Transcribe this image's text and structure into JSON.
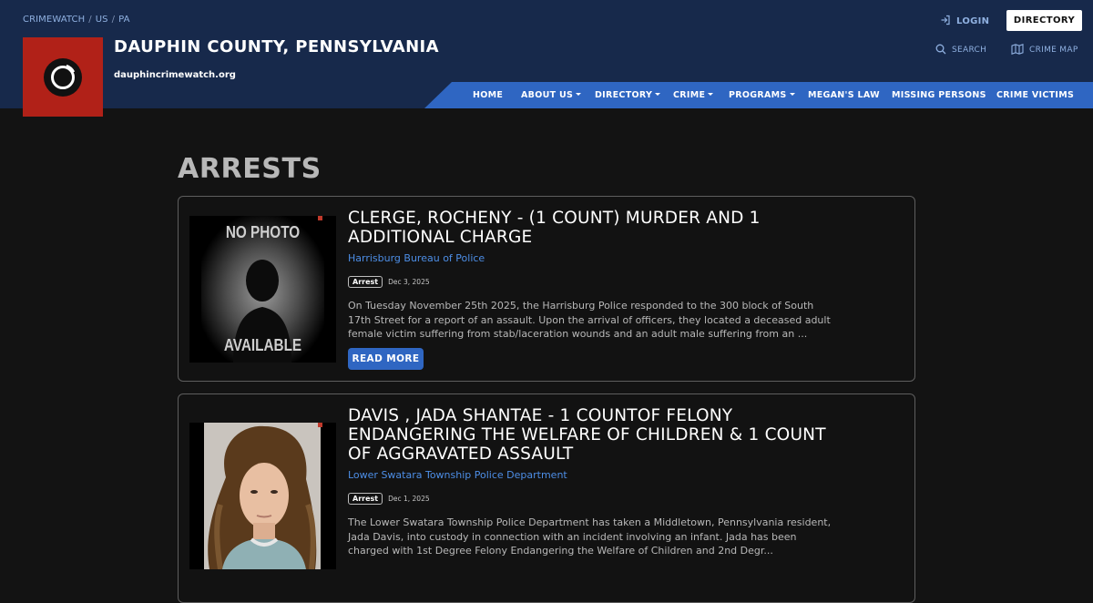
{
  "breadcrumb": [
    "CRIMEWATCH",
    "US",
    "PA"
  ],
  "site": {
    "title": "DAUPHIN COUNTY, PENNSYLVANIA",
    "url": "dauphincrimewatch.org"
  },
  "header_links": {
    "login": "LOGIN",
    "directory": "DIRECTORY",
    "search": "SEARCH",
    "crime_map": "CRIME MAP"
  },
  "nav": [
    {
      "label": "HOME",
      "dropdown": false
    },
    {
      "label": "ABOUT US",
      "dropdown": true
    },
    {
      "label": "DIRECTORY",
      "dropdown": true
    },
    {
      "label": "CRIME",
      "dropdown": true
    },
    {
      "label": "PROGRAMS",
      "dropdown": true
    },
    {
      "label": "MEGAN'S LAW",
      "dropdown": false
    },
    {
      "label": "MISSING PERSONS",
      "dropdown": false
    },
    {
      "label": "CRIME VICTIMS",
      "dropdown": false
    }
  ],
  "page_title": "ARRESTS",
  "arrests": [
    {
      "title": "CLERGE, ROCHENY - (1 COUNT) MURDER AND 1 ADDITIONAL CHARGE",
      "agency": "Harrisburg Bureau of Police",
      "badge": "Arrest",
      "date": "Dec 3, 2025",
      "summary": "On Tuesday November 25th 2025, the Harrisburg Police responded to the 300 block of South 17th Street for a report of an assault. Upon the arrival of officers, they located a deceased adult female victim suffering from stab/laceration wounds and an adult male suffering from an ...",
      "photo": {
        "type": "placeholder",
        "line1": "NO PHOTO",
        "line2": "AVAILABLE"
      },
      "read_more": "READ MORE"
    },
    {
      "title": "DAVIS , JADA SHANTAE - 1 COUNTOF FELONY ENDANGERING THE WELFARE OF CHILDREN & 1 COUNT OF AGGRAVATED ASSAULT",
      "agency": "Lower Swatara Township Police Department",
      "badge": "Arrest",
      "date": "Dec 1, 2025",
      "summary": "The Lower Swatara Township Police Department has taken a Middletown, Pennsylvania resident, Jada Davis, into custody in connection with an incident involving an infant. Jada has been charged with 1st Degree Felony Endangering the Welfare of Children and 2nd Degr...",
      "photo": {
        "type": "mugshot"
      }
    }
  ],
  "colors": {
    "header_bg": "#17294b",
    "nav_bg": "#2f66c2",
    "logo_bg": "#b12118",
    "link": "#4d8ee6",
    "page_bg": "#131313"
  }
}
